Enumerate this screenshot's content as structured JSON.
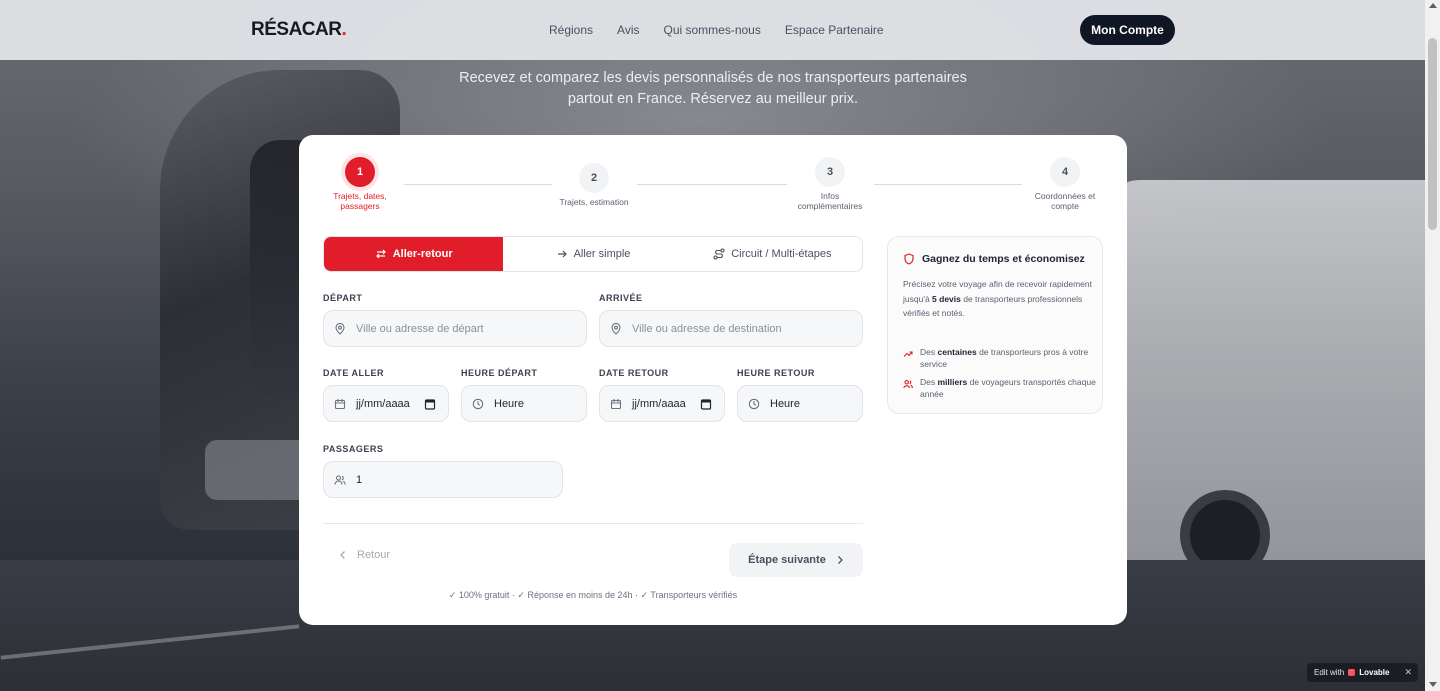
{
  "header": {
    "logo_text": "RÉSACAR",
    "logo_dot": ".",
    "nav": [
      "Régions",
      "Avis",
      "Qui sommes-nous",
      "Espace Partenaire"
    ],
    "account_button": "Mon Compte"
  },
  "hero": {
    "subtitle_line1": "Recevez et comparez les devis personnalisés de nos transporteurs partenaires",
    "subtitle_line2": "partout en France. Réservez au meilleur prix."
  },
  "stepper": {
    "steps": [
      {
        "number": "1",
        "label_line1": "Trajets, dates,",
        "label_line2": "passagers",
        "active": true
      },
      {
        "number": "2",
        "label_line1": "Trajets, estimation",
        "label_line2": "",
        "active": false
      },
      {
        "number": "3",
        "label_line1": "Infos",
        "label_line2": "complémentaires",
        "active": false
      },
      {
        "number": "4",
        "label_line1": "Coordonnées et",
        "label_line2": "compte",
        "active": false
      }
    ]
  },
  "trip_tabs": {
    "round_trip": "Aller-retour",
    "one_way": "Aller simple",
    "circuit": "Circuit / Multi-étapes",
    "selected": "Aller-retour"
  },
  "form": {
    "departure": {
      "label": "DÉPART",
      "placeholder": "Ville ou adresse de départ"
    },
    "arrival": {
      "label": "ARRIVÉE",
      "placeholder": "Ville ou adresse de destination"
    },
    "date_out": {
      "label": "DATE ALLER",
      "value": "jj/mm/aaaa"
    },
    "time_out": {
      "label": "HEURE DÉPART",
      "value": "Heure"
    },
    "date_return": {
      "label": "DATE RETOUR",
      "value": "jj/mm/aaaa"
    },
    "time_return": {
      "label": "HEURE RETOUR",
      "value": "Heure"
    },
    "passengers": {
      "label": "PASSAGERS",
      "value": "1"
    }
  },
  "actions": {
    "back": "Retour",
    "next": "Étape suivante",
    "footnote": "✓ 100% gratuit · ✓ Réponse en moins de 24h · ✓ Transporteurs vérifiés"
  },
  "panel": {
    "title": "Gagnez du temps et économisez",
    "text_pre": "Précisez votre voyage afin de recevoir rapidement jusqu'à ",
    "text_bold": "5 devis",
    "text_post": " de transporteurs professionnels vérifiés et notés.",
    "perk1_pre": "Des ",
    "perk1_bold": "centaines",
    "perk1_post": " de transporteurs pros à votre service",
    "perk2_pre": "Des ",
    "perk2_bold": "milliers",
    "perk2_post": " de voyageurs transportés chaque année"
  },
  "badge": {
    "prefix": "Edit with",
    "brand": "Lovable",
    "close": "✕"
  },
  "colors": {
    "accent": "#e11d2a",
    "dark": "#0f1624"
  }
}
